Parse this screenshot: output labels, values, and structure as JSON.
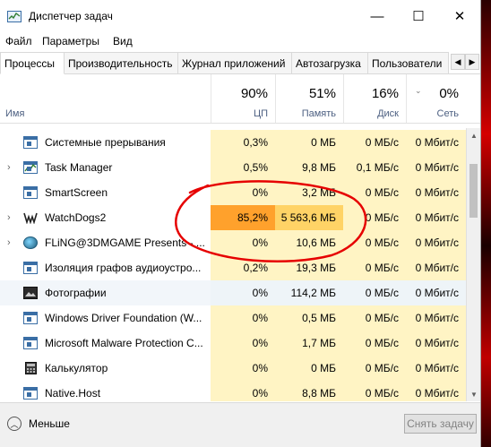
{
  "window": {
    "title": "Диспетчер задач",
    "icon": "task-manager-icon",
    "controls": {
      "minimize": "—",
      "maximize": "☐",
      "close": "✕"
    }
  },
  "menu": [
    "Файл",
    "Параметры",
    "Вид"
  ],
  "tabs": [
    {
      "label": "Процессы",
      "active": true
    },
    {
      "label": "Производительность",
      "active": false
    },
    {
      "label": "Журнал приложений",
      "active": false
    },
    {
      "label": "Автозагрузка",
      "active": false
    },
    {
      "label": "Пользователи",
      "active": false
    }
  ],
  "tab_nav": {
    "prev": "◀",
    "next": "▶"
  },
  "columns": {
    "name": "Имя",
    "cpu": {
      "percent": "90%",
      "label": "ЦП"
    },
    "memory": {
      "percent": "51%",
      "label": "Память"
    },
    "disk": {
      "percent": "16%",
      "label": "Диск"
    },
    "network": {
      "percent": "0%",
      "label": "Сеть"
    },
    "sort_arrow": "⌄"
  },
  "processes": [
    {
      "name": "Системные прерывания",
      "icon": "window-icon",
      "expandable": false,
      "cpu": "0,3%",
      "memory": "0 МБ",
      "disk": "0 МБ/с",
      "network": "0 Мбит/с"
    },
    {
      "name": "Task Manager",
      "icon": "task-manager-icon",
      "expandable": true,
      "cpu": "0,5%",
      "memory": "9,8 МБ",
      "disk": "0,1 МБ/с",
      "network": "0 Мбит/с"
    },
    {
      "name": "SmartScreen",
      "icon": "window-icon",
      "expandable": false,
      "cpu": "0%",
      "memory": "3,2 МБ",
      "disk": "0 МБ/с",
      "network": "0 Мбит/с"
    },
    {
      "name": "WatchDogs2",
      "icon": "watchdogs-icon",
      "expandable": true,
      "cpu": "85,2%",
      "memory": "5 563,6 МБ",
      "disk": "0 МБ/с",
      "network": "0 Мбит/с"
    },
    {
      "name": "FLiNG@3DMGAME Presents - ...",
      "icon": "fling-icon",
      "expandable": true,
      "cpu": "0%",
      "memory": "10,6 МБ",
      "disk": "0 МБ/с",
      "network": "0 Мбит/с"
    },
    {
      "name": "Изоляция графов аудиоустро...",
      "icon": "window-icon",
      "expandable": false,
      "cpu": "0,2%",
      "memory": "19,3 МБ",
      "disk": "0 МБ/с",
      "network": "0 Мбит/с"
    },
    {
      "name": "Фотографии",
      "icon": "photo-icon",
      "expandable": false,
      "cpu": "0%",
      "memory": "114,2 МБ",
      "disk": "0 МБ/с",
      "network": "0 Мбит/с"
    },
    {
      "name": "Windows Driver Foundation (W...",
      "icon": "window-icon",
      "expandable": false,
      "cpu": "0%",
      "memory": "0,5 МБ",
      "disk": "0 МБ/с",
      "network": "0 Мбит/с"
    },
    {
      "name": "Microsoft Malware Protection C...",
      "icon": "window-icon",
      "expandable": false,
      "cpu": "0%",
      "memory": "1,7 МБ",
      "disk": "0 МБ/с",
      "network": "0 Мбит/с"
    },
    {
      "name": "Калькулятор",
      "icon": "calculator-icon",
      "expandable": false,
      "cpu": "0%",
      "memory": "0 МБ",
      "disk": "0 МБ/с",
      "network": "0 Мбит/с"
    },
    {
      "name": "Native.Host",
      "icon": "window-icon",
      "expandable": false,
      "cpu": "0%",
      "memory": "8,8 МБ",
      "disk": "0 МБ/с",
      "network": "0 Мбит/с"
    }
  ],
  "footer": {
    "fewer_details": "Меньше",
    "end_task": "Снять задачу"
  },
  "colors": {
    "accent": "#4d6082",
    "usage_low": "#fff4c4",
    "usage_high": "#ffa12c",
    "usage_mid": "#ffd366",
    "annotation": "#e60000"
  }
}
